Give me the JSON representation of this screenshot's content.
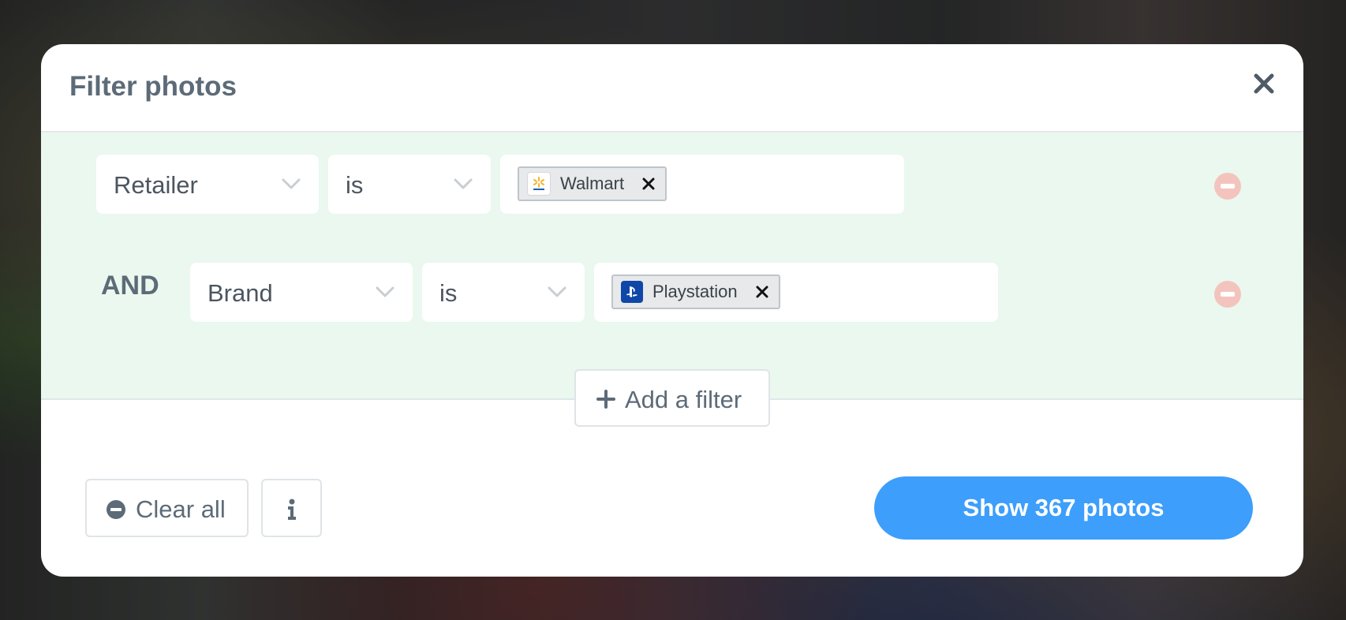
{
  "modal": {
    "title": "Filter photos",
    "close_icon": "close-icon"
  },
  "filters": [
    {
      "connector": "",
      "field": "Retailer",
      "operator": "is",
      "values": [
        {
          "label": "Walmart",
          "icon": "walmart-logo-icon"
        }
      ]
    },
    {
      "connector": "AND",
      "field": "Brand",
      "operator": "is",
      "values": [
        {
          "label": "Playstation",
          "icon": "playstation-logo-icon"
        }
      ]
    }
  ],
  "add_filter": {
    "label": "Add a filter",
    "icon": "plus-icon"
  },
  "footer": {
    "clear_all_label": "Clear all",
    "clear_all_icon": "minus-circle-icon",
    "info_icon": "info-icon",
    "primary_label": "Show 367 photos"
  },
  "colors": {
    "filter_area": "#eaf8ef",
    "primary": "#3d9efb",
    "remove": "#f3c4bd",
    "title": "#5d6b78"
  }
}
